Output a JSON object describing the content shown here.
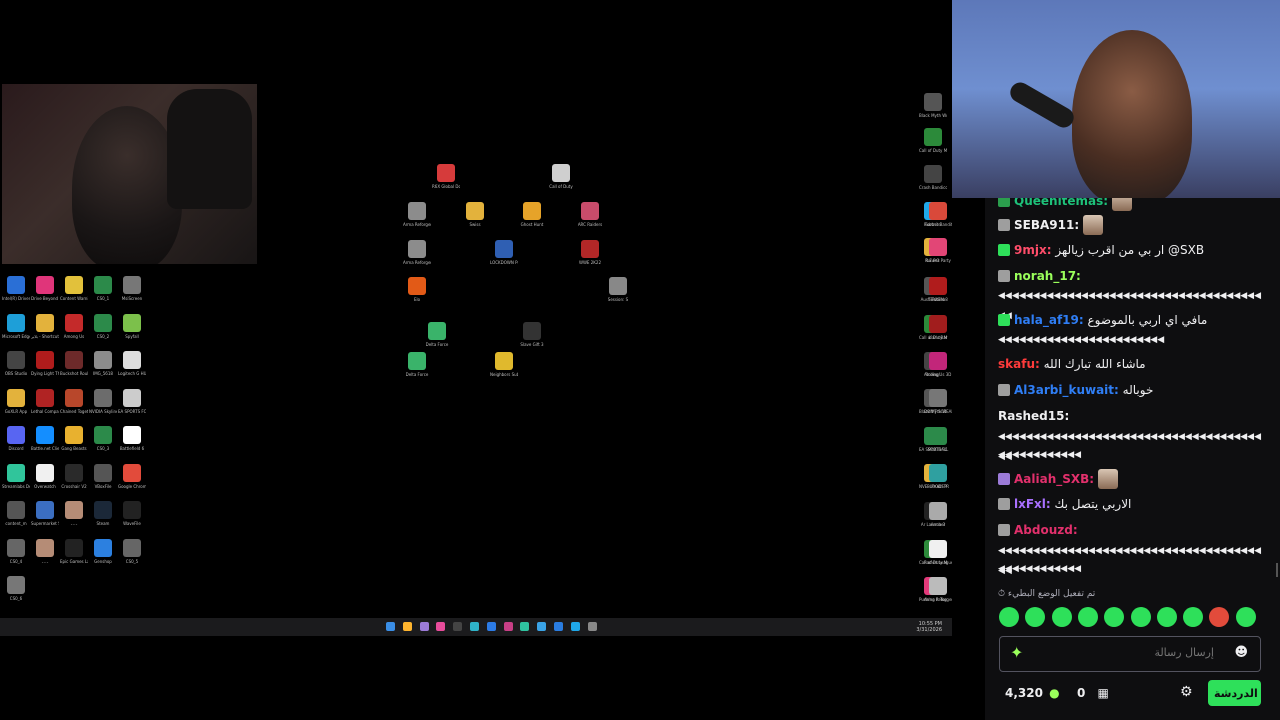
{
  "desktop": {
    "left_icons": [
      {
        "label": "Intel(R) Drivers",
        "color": "#2a6fd6"
      },
      {
        "label": "Drive Beyond Horizons",
        "color": "#e0357a"
      },
      {
        "label": "Content Warning",
        "color": "#e2c13b"
      },
      {
        "label": "CS0_1",
        "color": "#2c8a4a"
      },
      {
        "label": "MsiScreen",
        "color": "#777"
      },
      {
        "label": "Microsoft Edge",
        "color": "#1e9fd8"
      },
      {
        "label": "بلاير - Shortcut",
        "color": "#e3b23c"
      },
      {
        "label": "Among Us",
        "color": "#c42a2a"
      },
      {
        "label": "CS0_2",
        "color": "#2c8a4a"
      },
      {
        "label": "Spyfall",
        "color": "#7cc04b"
      },
      {
        "label": "OBS Studio",
        "color": "#444"
      },
      {
        "label": "Dying Light The Beast",
        "color": "#b01c1c"
      },
      {
        "label": "Buckshot Roulette",
        "color": "#6d2a2a"
      },
      {
        "label": "IMG_5618",
        "color": "#8c8c8c"
      },
      {
        "label": "Logitech G HUB",
        "color": "#ddd"
      },
      {
        "label": "GoXLR App",
        "color": "#e3b23c"
      },
      {
        "label": "Lethal Company",
        "color": "#b02323"
      },
      {
        "label": "Chained Together",
        "color": "#b8472b"
      },
      {
        "label": "NVIDIA Skyline",
        "color": "#6c6c6c"
      },
      {
        "label": "EA SPORTS FC 26",
        "color": "#ccc"
      },
      {
        "label": "Discord",
        "color": "#5865f2"
      },
      {
        "label": "Battle.net Client",
        "color": "#148eff"
      },
      {
        "label": "Gang Beasts",
        "color": "#e8b12f"
      },
      {
        "label": "CS0_3",
        "color": "#2c8a4a"
      },
      {
        "label": "Battlefield 6",
        "color": "#fff"
      },
      {
        "label": "Streamlabs Desktop",
        "color": "#30c59b"
      },
      {
        "label": "Overwatch",
        "color": "#f0f0f0"
      },
      {
        "label": "Crosshair V2",
        "color": "#2a2a2a"
      },
      {
        "label": "VBoxFile",
        "color": "#555"
      },
      {
        "label": "Google Chrome",
        "color": "#e24b3b"
      },
      {
        "label": "content_m",
        "color": "#555"
      },
      {
        "label": "Supermarket Simulator",
        "color": "#3b6ec1"
      },
      {
        "label": "ـ ـ ـ",
        "color": "#b58c76"
      },
      {
        "label": "Steam",
        "color": "#1b2838"
      },
      {
        "label": "WaveFile",
        "color": "#222"
      },
      {
        "label": "CS0_4",
        "color": "#666"
      },
      {
        "label": "ـ ـ ـ",
        "color": "#b58c76"
      },
      {
        "label": "Epic Games Launcher",
        "color": "#222"
      },
      {
        "label": "Genshop",
        "color": "#2c80e0"
      },
      {
        "label": "CS0_5",
        "color": "#666"
      },
      {
        "label": "CS0_6",
        "color": "#777"
      }
    ],
    "center_icons": [
      {
        "label": "R6X Global Domination",
        "color": "#d63b3b"
      },
      {
        "label": "Call of Duty",
        "color": "#cfcfcf"
      },
      {
        "label": "Arma Reforger",
        "color": "#8c8c8c"
      },
      {
        "label": "Swiss",
        "color": "#e3b23c"
      },
      {
        "label": "Ghost Hunt",
        "color": "#e6a329"
      },
      {
        "label": "ARC Raiders",
        "color": "#c84c6b"
      },
      {
        "label": "Arma Reforger",
        "color": "#8c8c8c"
      },
      {
        "label": "LOCKDOWN Protocol",
        "color": "#2f5fb3"
      },
      {
        "label": "WWE 2K22",
        "color": "#b32727"
      },
      {
        "label": "Elo",
        "color": "#e25a17"
      },
      {
        "label": "Session: S",
        "color": "#888"
      },
      {
        "label": "Delta Force",
        "color": "#3ab36a"
      },
      {
        "label": "Slave Gift 3",
        "color": "#333"
      },
      {
        "label": "Delta Force",
        "color": "#3ab36a"
      },
      {
        "label": "Neighbors Suburban",
        "color": "#e0b92d"
      }
    ],
    "right_icons": [
      {
        "label": "Black Myth Wukong",
        "color": "#555"
      },
      {
        "label": "Call of Duty Modern",
        "color": "#2c8a3a"
      },
      {
        "label": "Crash Bandicoot",
        "color": "#444"
      },
      {
        "label": "Fortnite",
        "color": "#1fa8e9"
      },
      {
        "label": "Rubber Bandits",
        "color": "#d9493a"
      },
      {
        "label": "R.E.P.O.",
        "color": "#e3b23c"
      },
      {
        "label": "Runner Party",
        "color": "#e24676"
      },
      {
        "label": "Austi Fatima",
        "color": "#555"
      },
      {
        "label": "TEKKEN 8",
        "color": "#b01c1c"
      },
      {
        "label": "Call of Duty Modern W",
        "color": "#2c8a3a"
      },
      {
        "label": "Liar's Bar",
        "color": "#a11d1d"
      },
      {
        "label": "Rolling!",
        "color": "#444"
      },
      {
        "label": "Among Us 3D Game",
        "color": "#c2267a"
      },
      {
        "label": "Black Myth Wukong",
        "color": "#555"
      },
      {
        "label": "DON'T SCREAM",
        "color": "#777"
      },
      {
        "label": "EA SPORTS FC 25",
        "color": "#2c8a4a"
      },
      {
        "label": "SPOTBALL",
        "color": "#2c8a4a"
      },
      {
        "label": "NVE - Prudit Package",
        "color": "#e3b23c"
      },
      {
        "label": "BLOODSTR",
        "color": "#2fa0a0"
      },
      {
        "label": "Ar Launcher",
        "color": "#222"
      },
      {
        "label": "Arma 3",
        "color": "#aaa"
      },
      {
        "label": "Call of Duty Modern",
        "color": "#2c8a3a"
      },
      {
        "label": "Rocket League",
        "color": "#f0f0f0"
      },
      {
        "label": "Pushing It Together",
        "color": "#e23a7a"
      },
      {
        "label": "Arma Reforger",
        "color": "#bbb"
      }
    ]
  },
  "taskbar": {
    "clock_time": "10:55 PM",
    "clock_date": "3/31/2026",
    "apps": [
      "#3a8ee6",
      "#ffb52e",
      "#9c7bd8",
      "#e84c9b",
      "#444",
      "#2fb3c9",
      "#2c7be5",
      "#c83f86",
      "#2fc3a0",
      "#3aa3e6",
      "#2a7de1",
      "#1fa8e9",
      "#888"
    ]
  },
  "chat": {
    "messages": [
      {
        "user": "Queenitemas:",
        "color": "#1ec17a",
        "text": "",
        "badge": "#2b9e4d",
        "avatar": true,
        "partial": true
      },
      {
        "user": "SEBA911:",
        "color": "#efeff1",
        "text": "",
        "badge": "#9e9e9e",
        "avatar": true
      },
      {
        "user": "9mjx:",
        "color": "#ff4d6a",
        "text": "ار بي من اقرب زيالهز @SXB",
        "badge": "#2ee05a"
      },
      {
        "user": "norah_17:",
        "color": "#9aff5b",
        "text": "",
        "badge": "#9e9e9e"
      },
      {
        "wrap": "◀◀◀◀◀◀◀◀◀◀◀◀◀◀◀◀◀◀◀◀◀◀◀◀◀◀◀◀◀◀◀◀◀◀◀◀◀◀◀◀"
      },
      {
        "user": "hala_af19:",
        "color": "#2f7ef5",
        "text": "مافي اي اربي بالموضوع",
        "badge": "#2ee05a"
      },
      {
        "wrap": "◀◀◀◀◀◀◀◀◀◀◀◀◀◀◀◀◀◀◀◀◀◀◀◀"
      },
      {
        "user": "skafu:",
        "color": "#ff3b3b",
        "text": "ماشاء الله تبارك الله"
      },
      {
        "user": "Al3arbi_kuwait:",
        "color": "#2f7ef5",
        "text": "خوباله",
        "badge": "#9e9e9e"
      },
      {
        "user": "Rashed15:",
        "color": "#efeff1",
        "text": ""
      },
      {
        "wrap": "◀◀◀◀◀◀◀◀◀◀◀◀◀◀◀◀◀◀◀◀◀◀◀◀◀◀◀◀◀◀◀◀◀◀◀◀◀◀◀◀"
      },
      {
        "wrap": "◀◀◀◀◀◀◀◀◀◀◀◀"
      },
      {
        "user": "Aaliah_SXB:",
        "color": "#e2306c",
        "text": "",
        "badge": "#9c7bd8",
        "avatar": true
      },
      {
        "user": "lxFxl:",
        "color": "#a970ff",
        "text": "الاربي يتصل بك",
        "badge": "#9e9e9e"
      },
      {
        "user": "Abdouzd:",
        "color": "#e2306c",
        "text": "",
        "badge": "#9e9e9e"
      },
      {
        "wrap": "◀◀◀◀◀◀◀◀◀◀◀◀◀◀◀◀◀◀◀◀◀◀◀◀◀◀◀◀◀◀◀◀◀◀◀◀◀◀◀◀"
      },
      {
        "wrap": "◀◀◀◀◀◀◀◀◀◀◀◀"
      }
    ],
    "slow_mode_notice": "تم تفعيل الوضع البطيء",
    "emotes": [
      "#2ee05a",
      "#2ee05a",
      "#2ee05a",
      "#2ee05a",
      "#2ee05a",
      "#2ee05a",
      "#2ee05a",
      "#2ee05a",
      "#e24b3b",
      "#2ee05a"
    ],
    "input_placeholder": "إرسال رسالة",
    "points": "4,320",
    "bits": "0",
    "chat_button": "الدردشة",
    "accent": "#2ee05a"
  }
}
